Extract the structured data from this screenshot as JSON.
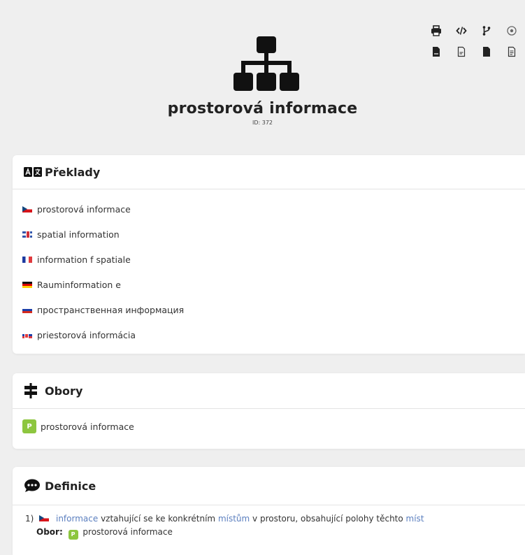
{
  "colors": {
    "background": "#efefef",
    "card": "#ffffff",
    "badge": "#8dc63f",
    "link": "#5b7fbf",
    "icon": "#222222"
  },
  "header": {
    "title": "prostorová informace",
    "id_text": "ID: 372",
    "hero_icon": "sitemap-icon",
    "toolbar": [
      "print-icon",
      "code-icon",
      "code-branch-icon",
      "settings-icon",
      "file-pdf-icon",
      "file-outline-icon",
      "file-solid-icon",
      "file-alt-icon"
    ]
  },
  "translations": {
    "title": "Překlady",
    "icon": "language-icon",
    "items": [
      {
        "flag": "cz",
        "text": "prostorová informace"
      },
      {
        "flag": "gb",
        "text": "spatial information"
      },
      {
        "flag": "fr",
        "text": "information f spatiale"
      },
      {
        "flag": "de",
        "text": "Rauminformation e"
      },
      {
        "flag": "ru",
        "text": "пространственная информация"
      },
      {
        "flag": "sk",
        "text": "priestorová informácia"
      }
    ]
  },
  "fields": {
    "title": "Obory",
    "icon": "signpost-icon",
    "items": [
      {
        "badge": "P",
        "text": "prostorová informace"
      }
    ]
  },
  "definitions": {
    "title": "Definice",
    "icon": "comment-dots-icon",
    "items": [
      {
        "number": "1)",
        "flag": "cz",
        "parts": [
          {
            "text": "informace",
            "link": true
          },
          {
            "text": " vztahující se ke konkrétním ",
            "link": false
          },
          {
            "text": "místům",
            "link": true
          },
          {
            "text": " v prostoru, obsahující polohy těchto ",
            "link": false
          },
          {
            "text": "míst",
            "link": true
          }
        ],
        "obor_label": "Obor:",
        "obor_badge": "P",
        "obor_text": "prostorová informace"
      }
    ]
  }
}
